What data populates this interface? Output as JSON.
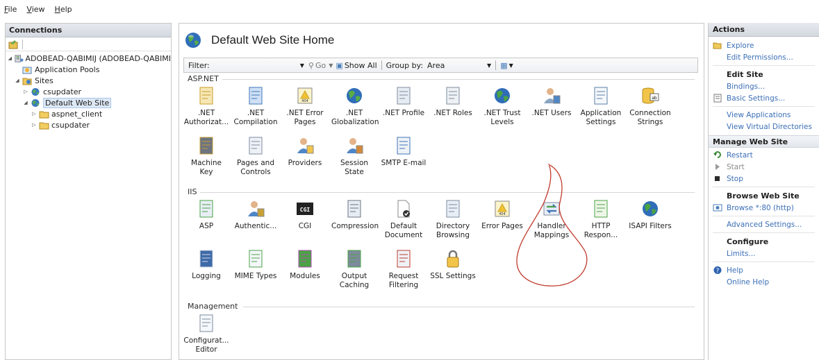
{
  "menu": {
    "file": "File",
    "view": "View",
    "help": "Help"
  },
  "connections": {
    "header": "Connections",
    "tree": [
      {
        "label": "ADOBEAD-QABIMIJ (ADOBEAD-QABIMI",
        "icon": "server-icon"
      },
      {
        "label": "Application Pools",
        "icon": "app-pool-icon"
      },
      {
        "label": "Sites",
        "icon": "sites-folder-icon"
      },
      {
        "label": "csupdater",
        "icon": "globe-icon"
      },
      {
        "label": "Default Web Site",
        "icon": "globe-icon"
      },
      {
        "label": "aspnet_client",
        "icon": "folder-icon"
      },
      {
        "label": "csupdater",
        "icon": "folder-icon"
      }
    ]
  },
  "main": {
    "title": "Default Web Site Home",
    "filter": {
      "label": "Filter:",
      "go": "Go",
      "show_all": "Show All",
      "group_by_label": "Group by:",
      "group_by_value": "Area"
    },
    "sections": {
      "aspnet": "ASP.NET",
      "iis": "IIS",
      "management": "Management"
    },
    "aspnet_features": [
      {
        "label": ".NET Authorizat...",
        "icon": "lock-page-icon"
      },
      {
        "label": ".NET Compilation",
        "icon": "compilation-icon"
      },
      {
        "label": ".NET Error Pages",
        "icon": "error-404-icon"
      },
      {
        "label": ".NET Globalization",
        "icon": "globe-icon"
      },
      {
        "label": ".NET Profile",
        "icon": "profile-icon"
      },
      {
        "label": ".NET Roles",
        "icon": "roles-icon"
      },
      {
        "label": ".NET Trust Levels",
        "icon": "trust-icon"
      },
      {
        "label": ".NET Users",
        "icon": "users-icon"
      },
      {
        "label": "Application Settings",
        "icon": "settings-list-icon"
      },
      {
        "label": "Connection Strings",
        "icon": "database-icon"
      },
      {
        "label": "Machine Key",
        "icon": "machine-key-icon"
      },
      {
        "label": "Pages and Controls",
        "icon": "pages-icon"
      },
      {
        "label": "Providers",
        "icon": "providers-icon"
      },
      {
        "label": "Session State",
        "icon": "session-icon"
      },
      {
        "label": "SMTP E-mail",
        "icon": "email-icon"
      }
    ],
    "iis_features": [
      {
        "label": "ASP",
        "icon": "asp-icon"
      },
      {
        "label": "Authentic...",
        "icon": "authentication-icon"
      },
      {
        "label": "CGI",
        "icon": "cgi-icon"
      },
      {
        "label": "Compression",
        "icon": "compression-icon"
      },
      {
        "label": "Default Document",
        "icon": "default-document-icon"
      },
      {
        "label": "Directory Browsing",
        "icon": "directory-icon"
      },
      {
        "label": "Error Pages",
        "icon": "error-404-icon"
      },
      {
        "label": "Handler Mappings",
        "icon": "handler-icon"
      },
      {
        "label": "HTTP Respon...",
        "icon": "http-icon"
      },
      {
        "label": "ISAPI Filters",
        "icon": "isapi-icon"
      },
      {
        "label": "Logging",
        "icon": "logging-icon"
      },
      {
        "label": "MIME Types",
        "icon": "mime-icon"
      },
      {
        "label": "Modules",
        "icon": "modules-icon"
      },
      {
        "label": "Output Caching",
        "icon": "caching-icon"
      },
      {
        "label": "Request Filtering",
        "icon": "filtering-icon"
      },
      {
        "label": "SSL Settings",
        "icon": "padlock-icon"
      }
    ],
    "management_features": [
      {
        "label": "Configurat... Editor",
        "icon": "config-editor-icon"
      }
    ]
  },
  "actions": {
    "header": "Actions",
    "explore": "Explore",
    "edit_permissions": "Edit Permissions...",
    "edit_site": "Edit Site",
    "bindings": "Bindings...",
    "basic_settings": "Basic Settings...",
    "view_applications": "View Applications",
    "view_virtual_directories": "View Virtual Directories",
    "manage_web_site": "Manage Web Site",
    "restart": "Restart",
    "start": "Start",
    "stop": "Stop",
    "browse_web_site": "Browse Web Site",
    "browse_80": "Browse *:80 (http)",
    "advanced_settings": "Advanced Settings...",
    "configure": "Configure",
    "limits": "Limits...",
    "help": "Help",
    "online_help": "Online Help"
  },
  "colors": {
    "link": "#3b6fb6",
    "annotation": "#c0392b",
    "header_bg": "#dde1e7"
  }
}
